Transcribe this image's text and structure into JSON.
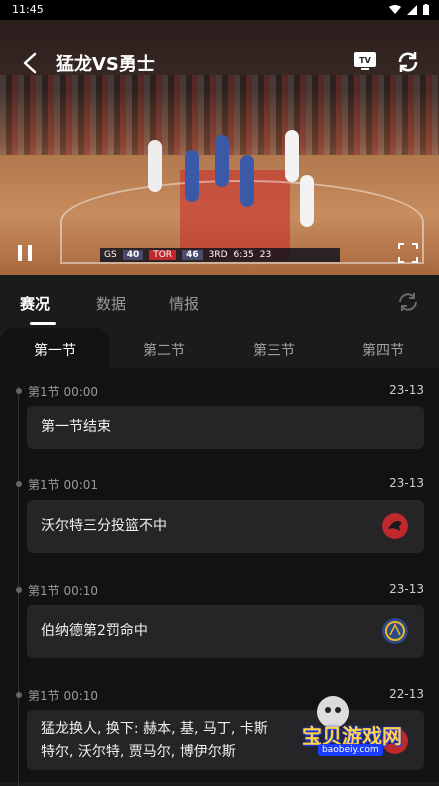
{
  "status_bar": {
    "time": "11:45"
  },
  "player": {
    "title": "猛龙VS勇士",
    "score_overlay": {
      "team_a": "GS",
      "score_a": "40",
      "team_b": "TOR",
      "score_b": "46",
      "quarter": "3RD",
      "clock": "6:35",
      "shot_clock": "23"
    }
  },
  "tabs": [
    {
      "label": "赛况",
      "active": true
    },
    {
      "label": "数据",
      "active": false
    },
    {
      "label": "情报",
      "active": false
    }
  ],
  "periods": [
    {
      "label": "第一节",
      "active": true
    },
    {
      "label": "第二节",
      "active": false
    },
    {
      "label": "第三节",
      "active": false
    },
    {
      "label": "第四节",
      "active": false
    }
  ],
  "events": [
    {
      "time": "第1节 00:00",
      "score": "23-13",
      "text": "第一节结束",
      "logo": ""
    },
    {
      "time": "第1节 00:01",
      "score": "23-13",
      "text": "沃尔特三分投篮不中",
      "logo": "raptors-logo"
    },
    {
      "time": "第1节 00:10",
      "score": "23-13",
      "text": "伯纳德第2罚命中",
      "logo": "warriors-logo"
    },
    {
      "time": "第1节 00:10",
      "score": "22-13",
      "text": "猛龙换人, 换下: 赫本, 基, 马丁, 卡斯",
      "text2": "特尔, 沃尔特, 贾马尔, 博伊尔斯",
      "logo": "raptors-logo"
    }
  ],
  "watermark": {
    "text": "宝贝游戏网",
    "url": "baobeiy.com"
  },
  "colors": {
    "background": "#1b1b1d",
    "card": "#252527",
    "raptors": "#c0282d",
    "warriors": "#2a4a8a"
  }
}
